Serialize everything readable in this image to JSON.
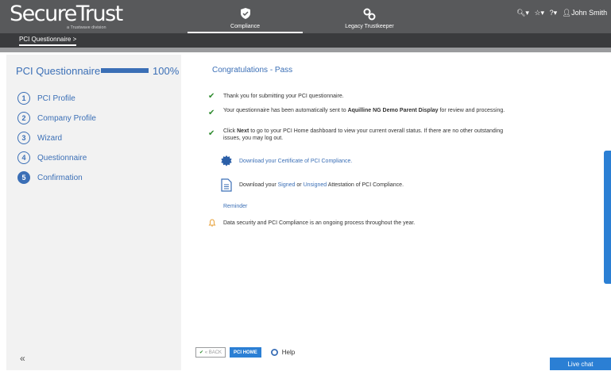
{
  "brand": {
    "logo": "SecureTrust",
    "sub": "a Trustwave division"
  },
  "nav": {
    "compliance": {
      "label": "Compliance",
      "icon": "shield-check-icon"
    },
    "legacy": {
      "label": "Legacy Trustkeeper",
      "icon": "link-icon"
    }
  },
  "tools": {
    "user": "John Smith"
  },
  "breadcrumb": {
    "label": "PCI Questionnaire  >"
  },
  "sidebar": {
    "title": "PCI Questionnaire",
    "progress_fraction": 1.0,
    "progress_text": "100%",
    "steps": [
      {
        "num": "1",
        "label": "PCI Profile"
      },
      {
        "num": "2",
        "label": "Company Profile"
      },
      {
        "num": "3",
        "label": "Wizard"
      },
      {
        "num": "4",
        "label": "Questionnaire"
      },
      {
        "num": "5",
        "label": "Confirmation"
      }
    ],
    "collapse": "«"
  },
  "main": {
    "title": "Congratulations - Pass",
    "msg1": "Thank you for submitting your PCI questionnaire.",
    "msg2_a": "Your questionnaire has been automatically sent to ",
    "msg2_b": "Aquilline NG Demo Parent Display",
    "msg2_c": " for review and processing.",
    "msg3_a": "Click ",
    "msg3_b": "Next",
    "msg3_c": " to go to your PCI Home dashboard to view your current overall status. If there are no other outstanding issues, you may log out.",
    "cert_link": "Download your Certificate of PCI Compliance.",
    "att_a": "Download your ",
    "att_signed": "Signed",
    "att_or": " or ",
    "att_unsigned": "Unsigned",
    "att_b": " Attestation of PCI Compliance.",
    "reminder": "Reminder",
    "note": "Data security and PCI Compliance is an ongoing process throughout the year."
  },
  "footer": {
    "back": "« BACK",
    "home": "PCI HOME",
    "help": "Help"
  },
  "livechat": "Live chat",
  "colors": {
    "accent": "#3b6fb6",
    "button": "#2b7fd4",
    "header": "#58595b",
    "check": "#2e8b2e"
  }
}
